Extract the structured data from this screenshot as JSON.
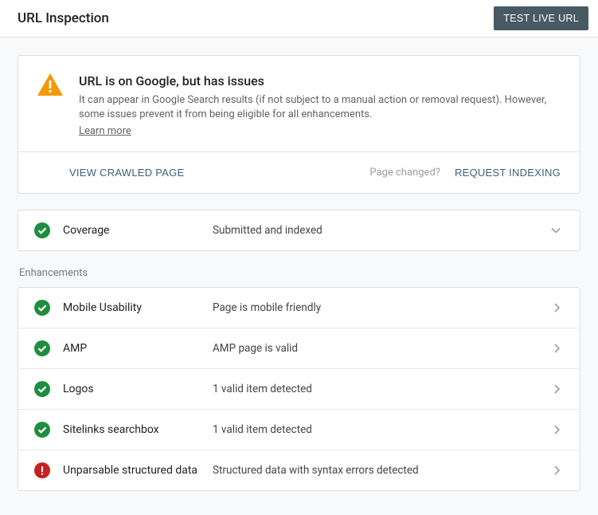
{
  "topbar": {
    "title": "URL Inspection",
    "test_live_label": "TEST LIVE URL"
  },
  "summary": {
    "title": "URL is on Google, but has issues",
    "description": "It can appear in Google Search results (if not subject to a manual action or removal request). However, some issues prevent it from being eligible for all enhancements.",
    "learn_more": "Learn more",
    "view_crawled": "VIEW CRAWLED PAGE",
    "page_changed": "Page changed?",
    "request_indexing": "REQUEST INDEXING"
  },
  "coverage": {
    "label": "Coverage",
    "value": "Submitted and indexed",
    "status": "check"
  },
  "enhancements": {
    "section_label": "Enhancements",
    "items": [
      {
        "status": "check",
        "label": "Mobile Usability",
        "value": "Page is mobile friendly"
      },
      {
        "status": "check",
        "label": "AMP",
        "value": "AMP page is valid"
      },
      {
        "status": "check",
        "label": "Logos",
        "value": "1 valid item detected"
      },
      {
        "status": "check",
        "label": "Sitelinks searchbox",
        "value": "1 valid item detected"
      },
      {
        "status": "error",
        "label": "Unparsable structured data",
        "value": "Structured data with syntax errors detected"
      }
    ]
  }
}
